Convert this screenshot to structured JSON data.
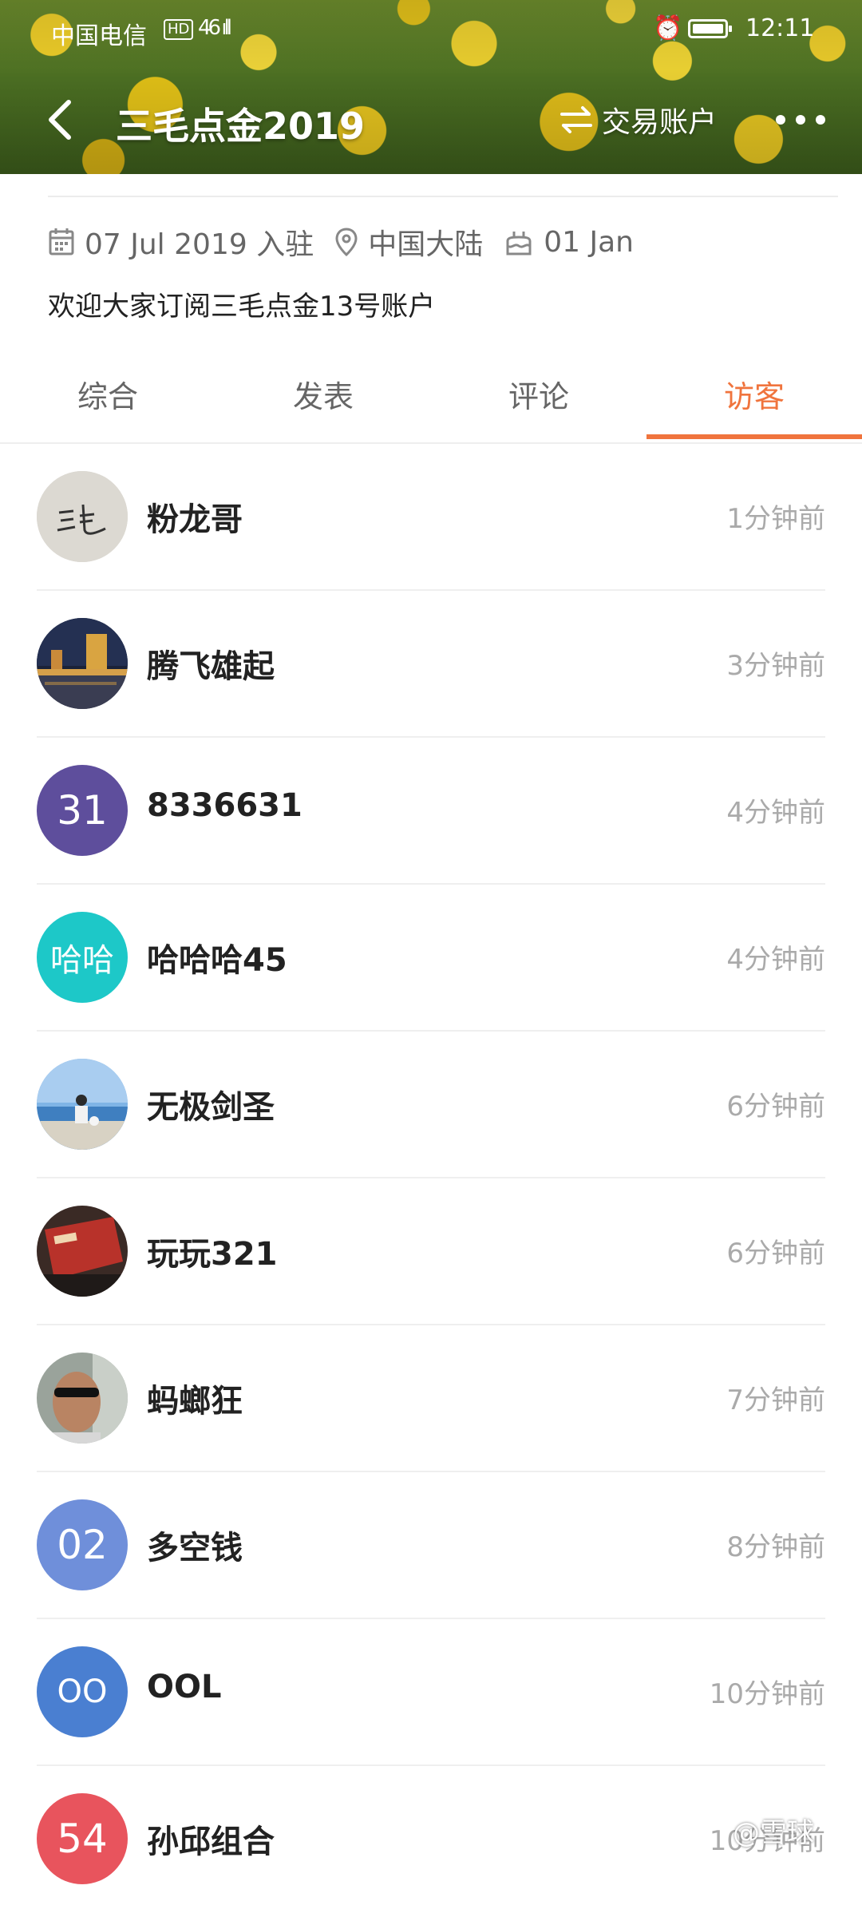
{
  "status_bar": {
    "carrier": "中国电信",
    "network_badge": "HD",
    "signal": "46 ıll",
    "time": "12:11"
  },
  "nav": {
    "title": "三毛点金2019",
    "switch_label": "交易账户",
    "icons": [
      "back-icon",
      "swap-icon",
      "more-icon"
    ]
  },
  "profile": {
    "join_date": "07 Jul 2019 入驻",
    "location": "中国大陆",
    "birthday": "01 Jan",
    "bio": "欢迎大家订阅三毛点金13号账户"
  },
  "tabs": {
    "items": [
      {
        "label": "综合"
      },
      {
        "label": "发表"
      },
      {
        "label": "评论"
      },
      {
        "label": "访客"
      }
    ],
    "active": "访客"
  },
  "visitors": [
    {
      "name": "粉龙哥",
      "time": "1分钟前",
      "avatar_type": "photo",
      "avatar_text": ""
    },
    {
      "name": "腾飞雄起",
      "time": "3分钟前",
      "avatar_type": "photo",
      "avatar_text": ""
    },
    {
      "name": "8336631",
      "time": "4分钟前",
      "avatar_type": "initials",
      "avatar_text": "31",
      "avatar_color": "#5e4e9c"
    },
    {
      "name": "哈哈哈45",
      "time": "4分钟前",
      "avatar_type": "initials",
      "avatar_text": "哈哈",
      "avatar_color": "#1dc8c8"
    },
    {
      "name": "无极剑圣",
      "time": "6分钟前",
      "avatar_type": "photo",
      "avatar_text": ""
    },
    {
      "name": "玩玩321",
      "time": "6分钟前",
      "avatar_type": "photo",
      "avatar_text": ""
    },
    {
      "name": "蚂螂狂",
      "time": "7分钟前",
      "avatar_type": "photo",
      "avatar_text": ""
    },
    {
      "name": "多空钱",
      "time": "8分钟前",
      "avatar_type": "initials",
      "avatar_text": "02",
      "avatar_color": "#6f8fda"
    },
    {
      "name": "OOL",
      "time": "10分钟前",
      "avatar_type": "initials",
      "avatar_text": "OO",
      "avatar_color": "#4a7fd1"
    },
    {
      "name": "孙邱组合",
      "time": "10分钟前",
      "avatar_type": "initials",
      "avatar_text": "54",
      "avatar_color": "#e8545d"
    }
  ],
  "colors": {
    "accent": "#f0743d",
    "text_secondary": "#666666",
    "time_text": "#aaaaaa"
  },
  "watermark": "@雪球"
}
